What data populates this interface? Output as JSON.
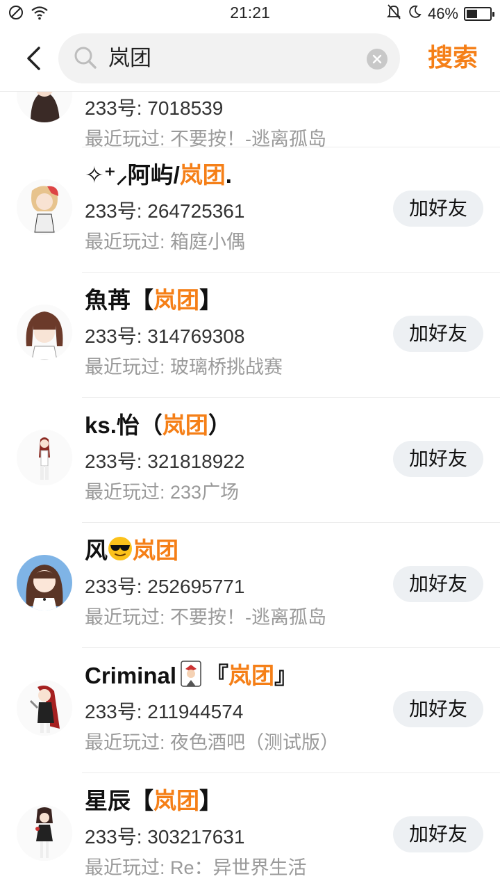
{
  "status_bar": {
    "time": "21:21",
    "battery_percent": "46%",
    "battery_level": 0.46,
    "icons": [
      "no-sim-icon",
      "wifi-icon",
      "mute-bell-icon",
      "moon-icon",
      "battery-icon"
    ]
  },
  "header": {
    "back_icon": "chevron-left-icon",
    "search_query": "岚团",
    "search_button": "搜索"
  },
  "partial_row": {
    "uid": "233号: 7018539",
    "recent_prefix": "最近玩过: ",
    "recent_game": "不要按！-逃离孤岛"
  },
  "users": [
    {
      "name_prefix": "✧⁺⸝阿屿/",
      "name_highlight": "岚团",
      "name_suffix": ".",
      "uid_label": "233号: ",
      "uid": "264725361",
      "recent_prefix": "最近玩过: ",
      "recent_game": "箱庭小偶",
      "add_label": "加好友"
    },
    {
      "name_prefix": "魚苒【",
      "name_highlight": "岚团",
      "name_suffix": "】",
      "uid_label": "233号: ",
      "uid": "314769308",
      "recent_prefix": "最近玩过: ",
      "recent_game": "玻璃桥挑战赛",
      "add_label": "加好友"
    },
    {
      "name_prefix": "ks.怡（",
      "name_highlight": "岚团",
      "name_suffix": "）",
      "uid_label": "233号: ",
      "uid": "321818922",
      "recent_prefix": "最近玩过: ",
      "recent_game": "233广场",
      "add_label": "加好友"
    },
    {
      "name_prefix": "风",
      "name_emoji": "sunglasses-emoji",
      "name_highlight": "岚团",
      "name_suffix": "",
      "uid_label": "233号: ",
      "uid": "252695771",
      "recent_prefix": "最近玩过: ",
      "recent_game": "不要按！-逃离孤岛",
      "add_label": "加好友"
    },
    {
      "name_prefix": "Criminal",
      "name_emoji": "joker-card-emoji",
      "name_mid": "『",
      "name_highlight": "岚团",
      "name_suffix": "』",
      "uid_label": "233号: ",
      "uid": "211944574",
      "recent_prefix": "最近玩过: ",
      "recent_game": "夜色酒吧（测试版）",
      "add_label": "加好友"
    },
    {
      "name_prefix": "星辰【",
      "name_highlight": "岚团",
      "name_suffix": "】",
      "uid_label": "233号: ",
      "uid": "303217631",
      "recent_prefix": "最近玩过: ",
      "recent_game": "Re：异世界生活",
      "add_label": "加好友"
    }
  ],
  "colors": {
    "accent": "#f57f17",
    "button_bg": "#edf0f3",
    "secondary_text": "#9a9a9a"
  }
}
